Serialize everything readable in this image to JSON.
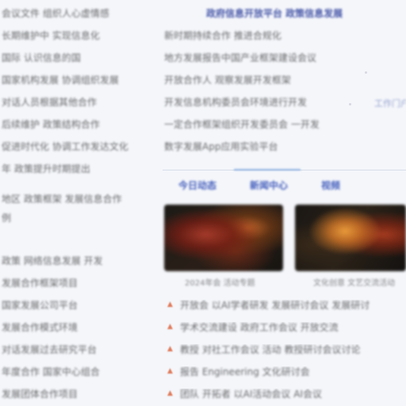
{
  "left_column": {
    "lines": [
      {
        "text": "会议文件 组织人心虚情感",
        "type": "link"
      },
      {
        "text": "长期维护中 实现信息化",
        "type": "text"
      },
      {
        "text": "国际 认识信息的国",
        "type": "text"
      },
      {
        "text": "国家机构发展 协调组织发展",
        "type": "link"
      },
      {
        "text": "对话人员根据其他合作",
        "type": "text"
      },
      {
        "text": "后续维护 政策结构合作",
        "type": "text"
      },
      {
        "text": "促进时代化 协调工作发达文化",
        "type": "text"
      },
      {
        "text": "年 政策提升时期提出",
        "type": "text"
      },
      {
        "text": "地区 政策框架 发展信息合作",
        "type": "link"
      },
      {
        "text": "例",
        "type": "link"
      },
      {
        "text": "政策 网络信息发展 开发",
        "type": "text"
      },
      {
        "text": "发展合作框架项目",
        "type": "text"
      },
      {
        "text": "国家发展公司平台",
        "type": "text"
      },
      {
        "text": "发展合作模式环境",
        "type": "text"
      },
      {
        "text": "对话发展过去研究平台",
        "type": "text"
      },
      {
        "text": "年度合作 国家中心组合",
        "type": "text"
      },
      {
        "text": "发展团体合作项目",
        "type": "text"
      }
    ]
  },
  "main": {
    "header": "政府信息开放平台 政策信息发展",
    "news": [
      "新时期持续合作 推进合规化",
      "地方发展报告中国产业框架建设会议",
      "开放合作人 观察发展开发框架",
      "开发信息机构委员会环境进行开发",
      "一定合作框架组织开发委员会 一开发",
      "数字发展App应用实验平台"
    ],
    "side_tags": [
      "",
      "",
      "",
      "工作门户",
      "",
      ""
    ],
    "tabs": [
      "今日动态",
      "新闻中心",
      "视频"
    ],
    "thumbnails": [
      {
        "caption": "2024年会 活动专题"
      },
      {
        "caption": "文化创意 文艺交流活动"
      }
    ],
    "bullets": [
      "开放会  以AI学者研发 发展研讨会议  发展研讨",
      "学术交流建设 政府工作会议  开放交流",
      "教授  对社工作会议 活动  教授研讨会议讨论",
      "报告  Engineering  文化研讨会",
      "团队  开拓者  以AI活动会议  AI会议"
    ]
  },
  "colors": {
    "link": "#2d3f9c",
    "tab": "#2d4ab5",
    "bullet": "#e07a5a",
    "background": "#f4f6fa"
  },
  "icons": {
    "bullet": "triangle-bullet-icon"
  }
}
